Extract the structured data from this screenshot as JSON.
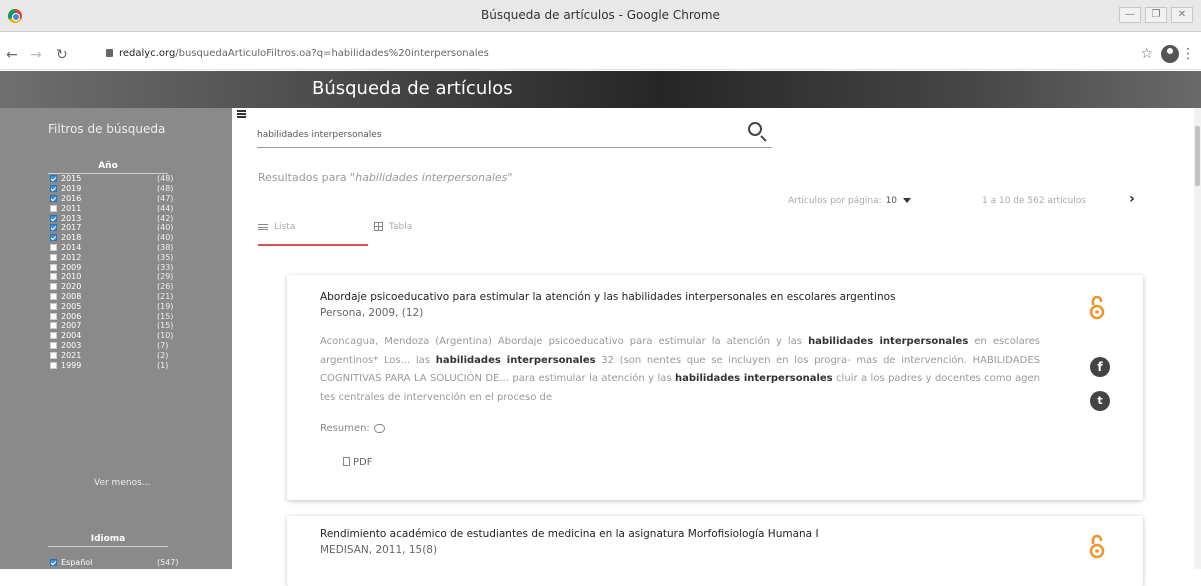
{
  "window": {
    "title": "Búsqueda de artículos - Google Chrome",
    "controls": [
      "—",
      "❐",
      "✕"
    ]
  },
  "address_bar": {
    "host": "redalyc.org",
    "path": "/busquedaArticuloFiltros.oa?q=habilidades%20interpersonales"
  },
  "header": {
    "title": "Búsqueda de artículos"
  },
  "sidebar": {
    "title": "Filtros de búsqueda",
    "years_heading": "Año",
    "years": [
      {
        "label": "2015",
        "count": "(48)",
        "checked": true
      },
      {
        "label": "2019",
        "count": "(48)",
        "checked": true
      },
      {
        "label": "2016",
        "count": "(47)",
        "checked": true
      },
      {
        "label": "2011",
        "count": "(44)",
        "checked": false
      },
      {
        "label": "2013",
        "count": "(42)",
        "checked": true
      },
      {
        "label": "2017",
        "count": "(40)",
        "checked": true
      },
      {
        "label": "2018",
        "count": "(40)",
        "checked": true
      },
      {
        "label": "2014",
        "count": "(38)",
        "checked": false
      },
      {
        "label": "2012",
        "count": "(35)",
        "checked": false
      },
      {
        "label": "2009",
        "count": "(33)",
        "checked": false
      },
      {
        "label": "2010",
        "count": "(29)",
        "checked": false
      },
      {
        "label": "2020",
        "count": "(26)",
        "checked": false
      },
      {
        "label": "2008",
        "count": "(21)",
        "checked": false
      },
      {
        "label": "2005",
        "count": "(19)",
        "checked": false
      },
      {
        "label": "2006",
        "count": "(15)",
        "checked": false
      },
      {
        "label": "2007",
        "count": "(15)",
        "checked": false
      },
      {
        "label": "2004",
        "count": "(10)",
        "checked": false
      },
      {
        "label": "2003",
        "count": "(7)",
        "checked": false
      },
      {
        "label": "2021",
        "count": "(2)",
        "checked": false
      },
      {
        "label": "1999",
        "count": "(1)",
        "checked": false
      }
    ],
    "see_less": "Ver menos...",
    "language_heading": "Idioma",
    "languages": [
      {
        "label": "Español",
        "count": "(547)",
        "checked": true
      }
    ]
  },
  "search": {
    "value": "habilidades interpersonales",
    "results_prefix": "Resultados para",
    "results_query": "\"habilidades interpersonales\""
  },
  "pagination": {
    "per_page_label": "Artículos por página:",
    "per_page_value": "10",
    "range": "1 a 10 de 562 artículos"
  },
  "view_tabs": {
    "list": "Lista",
    "table": "Tabla"
  },
  "results": [
    {
      "title": "Abordaje psicoeducativo para estimular la atención y las habilidades interpersonales en escolares argentinos",
      "source": "Persona, 2009, (12)",
      "snippet_html": "Aconcagua, Mendoza (Argentina) Abordaje psicoeducativo para estimular la atención y las <b>habilidades interpersonales</b> en escolares argentinos* Los... las <b>habilidades interpersonales</b> 32 (son nentes que se incluyen en los progra- mas de intervención. HABILIDADES COGNITIVAS PARA LA SOLUCIÓN DE... para estimular la atención y las <b>habilidades interpersonales</b> cluir a los padres y docentes como agen tes centrales de intervención en el proceso de",
      "summary_label": "Resumen:",
      "pdf_label": "PDF"
    },
    {
      "title": "Rendimiento académico de estudiantes de medicina en la asignatura Morfofisiología Humana I",
      "source": "MEDISAN, 2011, 15(8)"
    }
  ],
  "icons": {
    "facebook": "f",
    "twitter": "t"
  },
  "colors": {
    "sidebar": "#8a8a8a",
    "checkbox_checked": "#3b8fd9",
    "active_tab_underline": "#d9534f",
    "open_access": "#f0932b"
  }
}
